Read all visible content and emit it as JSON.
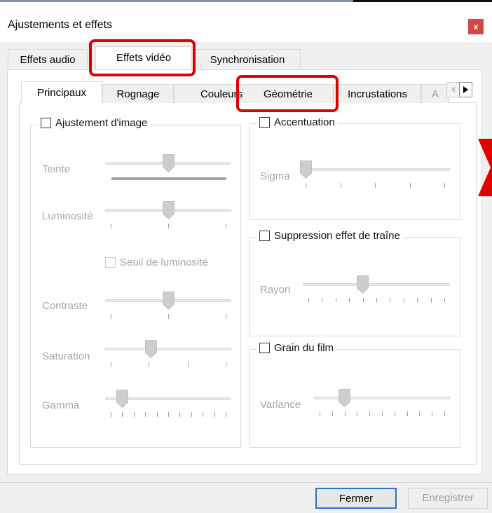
{
  "window": {
    "title": "Ajustements et effets",
    "close_label": "x"
  },
  "main_tabs": [
    "Effets audio",
    "Effets vidéo",
    "Synchronisation"
  ],
  "sub_tabs": [
    "Principaux",
    "Rognage",
    "Couleurs",
    "Géométrie",
    "Incrustations"
  ],
  "sub_tab_partial": "A",
  "left_group": {
    "checkbox_label": "Ajustement d'image",
    "rows": [
      {
        "label": "Teinte",
        "value": 0.5
      },
      {
        "label": "Luminosité",
        "value": 0.5
      },
      {
        "label": "Contraste",
        "value": 0.5
      },
      {
        "label": "Saturation",
        "value": 0.35
      },
      {
        "label": "Gamma",
        "value": 0.1
      }
    ],
    "threshold_label": "Seuil de luminosité"
  },
  "accentuation": {
    "checkbox_label": "Accentuation",
    "slider_label": "Sigma",
    "value": 0.0
  },
  "trainee": {
    "checkbox_label": "Suppression effet de traîne",
    "slider_label": "Rayon",
    "value": 0.4
  },
  "grain": {
    "checkbox_label": "Grain du film",
    "slider_label": "Variance",
    "value": 0.2
  },
  "buttons": {
    "close": "Fermer",
    "save": "Enregistrer"
  },
  "colors": {
    "highlight": "#e00000",
    "accent": "#2a74c9",
    "close_bg": "#d74444"
  }
}
